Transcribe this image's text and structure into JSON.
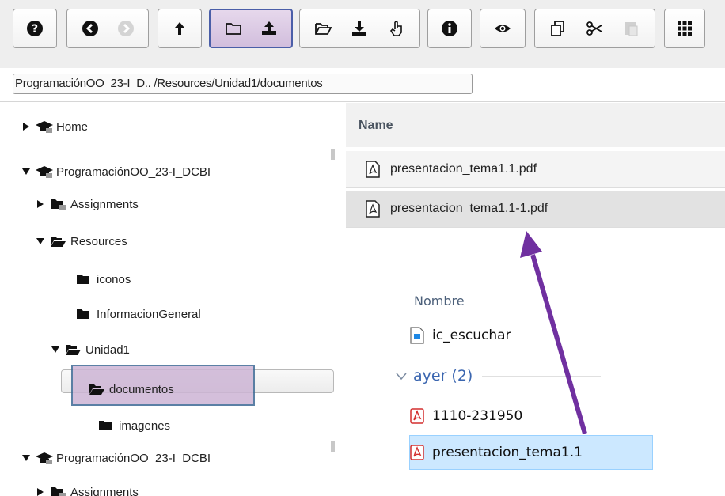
{
  "path": "ProgramaciónOO_23-I_D.. /Resources/Unidad1/documentos",
  "tree": {
    "items": [
      {
        "label": "Home",
        "expanded": false,
        "icon": "course-icon"
      },
      {
        "label": "ProgramaciónOO_23-I_DCBI",
        "expanded": true,
        "icon": "course-icon"
      },
      {
        "label": "Assignments",
        "expanded": false,
        "icon": "folder-icon"
      },
      {
        "label": "Resources",
        "expanded": true,
        "icon": "folder-open-icon"
      },
      {
        "label": "iconos",
        "icon": "folder-icon"
      },
      {
        "label": "InformacionGeneral",
        "icon": "folder-icon"
      },
      {
        "label": "Unidad1",
        "expanded": true,
        "icon": "folder-open-icon"
      },
      {
        "label": "documentos",
        "selected": true,
        "icon": "folder-open-icon"
      },
      {
        "label": "imagenes",
        "icon": "folder-icon"
      },
      {
        "label": "ProgramaciónOO_23-I_DCBI",
        "expanded": true,
        "icon": "course-icon"
      },
      {
        "label": "Assignments",
        "expanded": false,
        "icon": "folder-icon"
      }
    ]
  },
  "files": {
    "column_name": "Name",
    "rows": [
      {
        "name": "presentacion_tema1.1.pdf"
      },
      {
        "name": "presentacion_tema1.1-1.pdf",
        "selected": true
      }
    ]
  },
  "explorer": {
    "column_name": "Nombre",
    "top_item": "ic_escuchar",
    "group_label": "ayer (2)",
    "items": [
      {
        "name": "1110-231950"
      },
      {
        "name": "presentacion_tema1.1",
        "selected": true
      }
    ]
  },
  "colors": {
    "accent_highlight": "#cdb5d5",
    "arrow": "#7030a0",
    "explorer_selection": "#cce8ff",
    "pdf_red": "#d32f2f"
  },
  "toolbar": {
    "groups": [
      [
        "help-icon"
      ],
      [
        "back-icon",
        "forward-icon"
      ],
      [
        "up-icon"
      ],
      [
        "new-folder-icon",
        "upload-icon"
      ],
      [
        "open-folder-icon",
        "download-icon",
        "rename-icon"
      ],
      [
        "info-icon"
      ],
      [
        "preview-icon"
      ],
      [
        "copy-icon",
        "cut-icon",
        "paste-icon"
      ],
      [
        "grid-view-icon"
      ]
    ]
  }
}
